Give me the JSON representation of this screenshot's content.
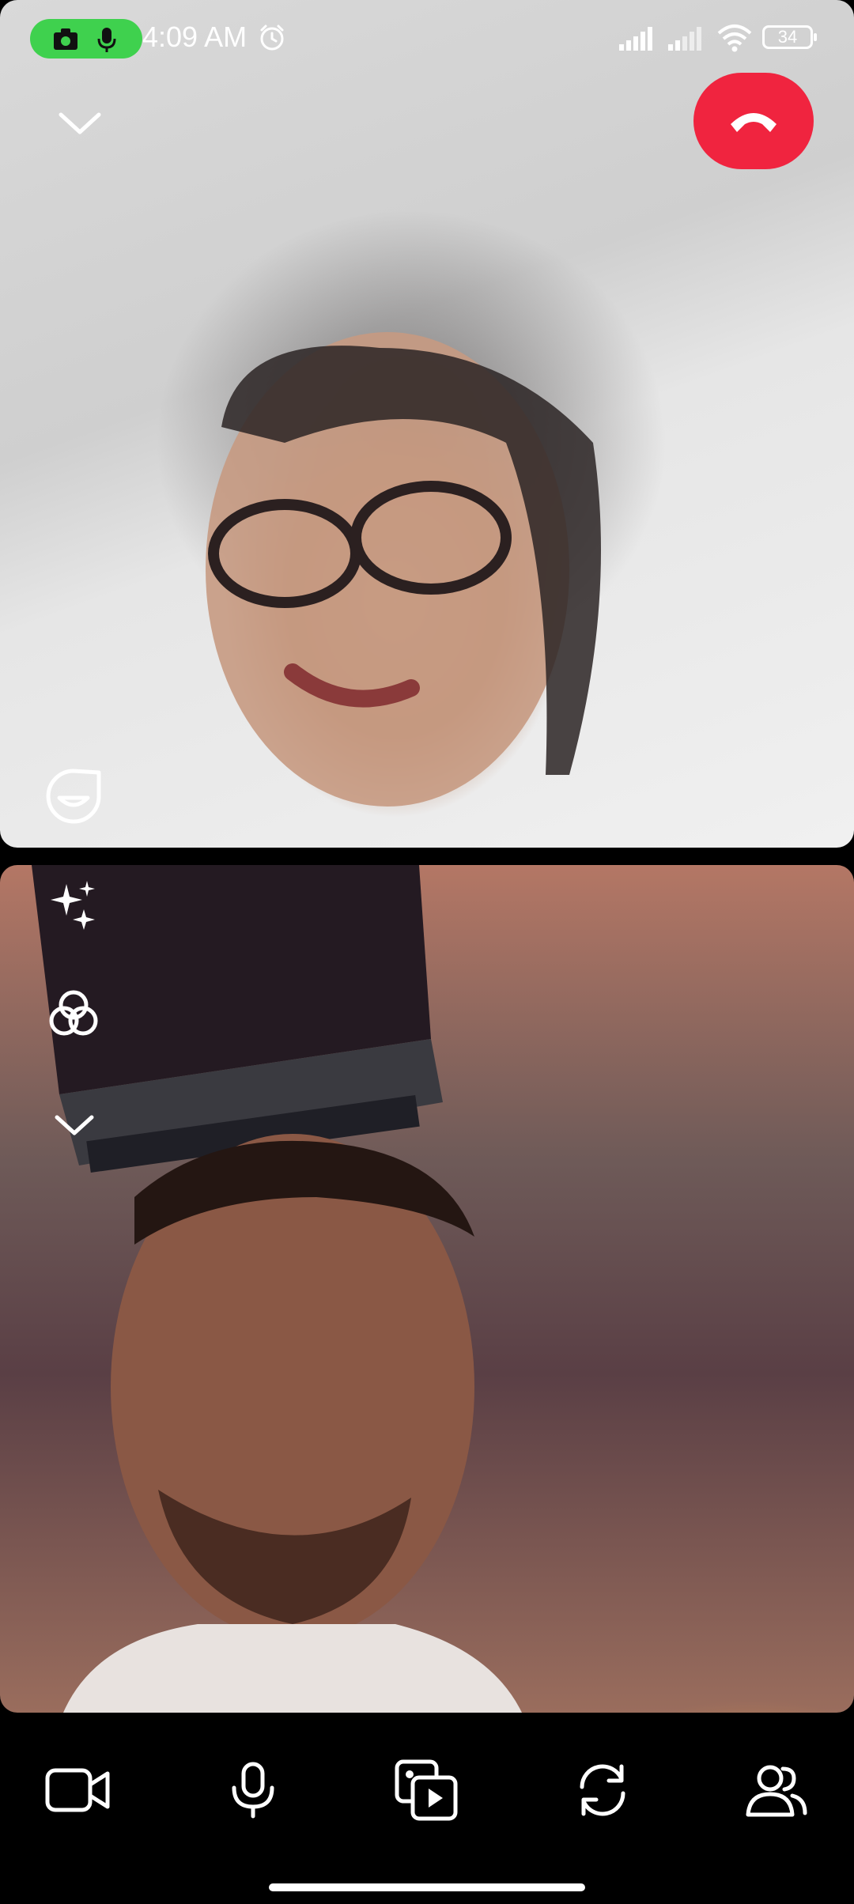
{
  "status_bar": {
    "time": "4:09 AM",
    "battery": "34",
    "recording_indicator_icons": [
      "camera-icon",
      "microphone-icon"
    ],
    "recording_color": "#3fd14e"
  },
  "remote_video": {
    "collapse_icon": "chevron-down-icon",
    "end_call_icon": "phone-hangup-icon",
    "end_call_color": "#f0243f",
    "reaction_icon": "emoji-reaction-icon"
  },
  "local_video": {
    "effects_icon": "sparkles-icon",
    "filters_icon": "filters-icon",
    "more_icon": "chevron-down-icon"
  },
  "controls": [
    {
      "name": "camera-toggle",
      "icon": "video-camera-icon"
    },
    {
      "name": "microphone-toggle",
      "icon": "microphone-icon"
    },
    {
      "name": "share-media",
      "icon": "media-share-icon"
    },
    {
      "name": "flip-camera",
      "icon": "flip-camera-icon"
    },
    {
      "name": "participants",
      "icon": "people-icon"
    }
  ]
}
